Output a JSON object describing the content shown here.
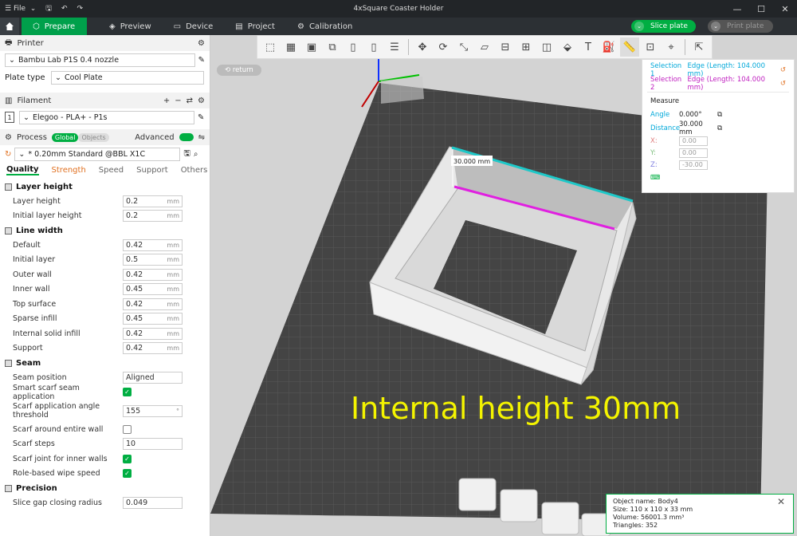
{
  "titlebar": {
    "menu_label": "File",
    "title": "4xSquare Coaster Holder"
  },
  "tabs": [
    {
      "label": "Prepare"
    },
    {
      "label": "Preview"
    },
    {
      "label": "Device"
    },
    {
      "label": "Project"
    },
    {
      "label": "Calibration"
    }
  ],
  "actions": {
    "slice": "Slice plate",
    "print": "Print plate"
  },
  "printer": {
    "section": "Printer",
    "name": "Bambu Lab P1S 0.4 nozzle",
    "plate_label": "Plate type",
    "plate_value": "Cool Plate"
  },
  "filament": {
    "section": "Filament",
    "index": "1",
    "name": "Elegoo - PLA+ - P1s"
  },
  "process": {
    "section": "Process",
    "global": "Global",
    "objects": "Objects",
    "advanced": "Advanced",
    "preset": "* 0.20mm Standard @BBL X1C"
  },
  "ptabs": [
    "Quality",
    "Strength",
    "Speed",
    "Support",
    "Others"
  ],
  "groups": {
    "layer": {
      "title": "Layer height",
      "params": [
        {
          "label": "Layer height",
          "value": "0.2",
          "unit": "mm"
        },
        {
          "label": "Initial layer height",
          "value": "0.2",
          "unit": "mm"
        }
      ]
    },
    "line": {
      "title": "Line width",
      "params": [
        {
          "label": "Default",
          "value": "0.42",
          "unit": "mm"
        },
        {
          "label": "Initial layer",
          "value": "0.5",
          "unit": "mm"
        },
        {
          "label": "Outer wall",
          "value": "0.42",
          "unit": "mm"
        },
        {
          "label": "Inner wall",
          "value": "0.45",
          "unit": "mm"
        },
        {
          "label": "Top surface",
          "value": "0.42",
          "unit": "mm"
        },
        {
          "label": "Sparse infill",
          "value": "0.45",
          "unit": "mm"
        },
        {
          "label": "Internal solid infill",
          "value": "0.42",
          "unit": "mm"
        },
        {
          "label": "Support",
          "value": "0.42",
          "unit": "mm"
        }
      ]
    },
    "seam": {
      "title": "Seam",
      "position_label": "Seam position",
      "position_value": "Aligned",
      "smart_label": "Smart scarf seam application",
      "angle_label": "Scarf application angle threshold",
      "angle_value": "155",
      "angle_unit": "°",
      "entire_label": "Scarf around entire wall",
      "steps_label": "Scarf steps",
      "steps_value": "10",
      "inner_label": "Scarf joint for inner walls",
      "role_label": "Role-based wipe speed"
    },
    "precision": {
      "title": "Precision",
      "slice_gap_label": "Slice gap closing radius",
      "slice_gap_value": "0.049"
    }
  },
  "viewport": {
    "return": "return",
    "dim_label": "30.000 mm",
    "caption": "Internal height 30mm"
  },
  "measure": {
    "sel1_label": "Selection 1",
    "sel1_value": "Edge (Length: 104.000 mm)",
    "sel2_label": "Selection 2",
    "sel2_value": "Edge (Length: 104.000 mm)",
    "title": "Measure",
    "angle_label": "Angle",
    "angle_value": "0.000°",
    "distance_label": "Distance",
    "distance_value": "30.000 mm",
    "x_label": "X:",
    "x_value": "0.00",
    "y_label": "Y:",
    "y_value": "0.00",
    "z_label": "Z:",
    "z_value": "-30.00"
  },
  "info": {
    "name": "Object name: Body4",
    "size": "Size: 110 x 110 x 33 mm",
    "volume": "Volume: 56001.3 mm³",
    "triangles": "Triangles: 352"
  }
}
